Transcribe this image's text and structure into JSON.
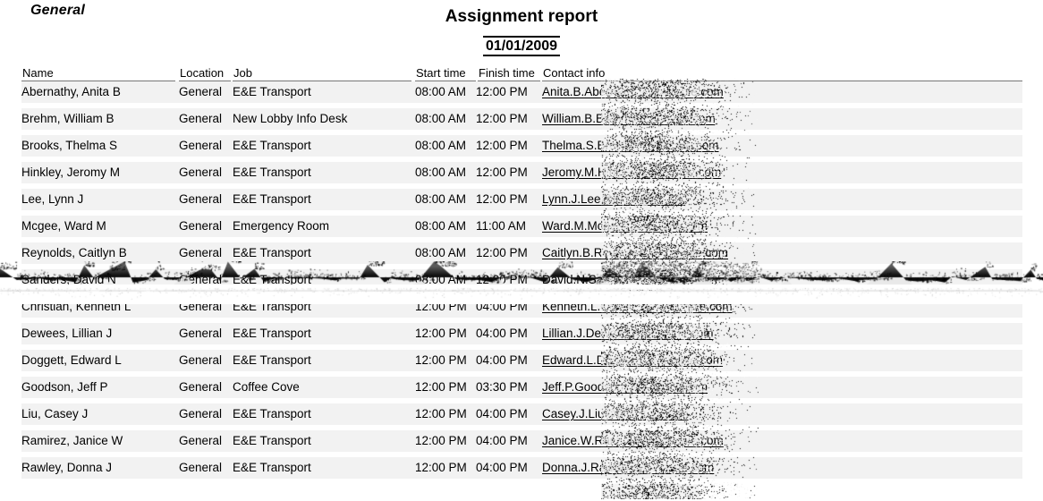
{
  "report": {
    "group_label": "General",
    "title": "Assignment report",
    "date": "01/01/2009"
  },
  "table": {
    "columns": [
      {
        "key": "name",
        "label": "Name"
      },
      {
        "key": "location",
        "label": "Location"
      },
      {
        "key": "job",
        "label": "Job"
      },
      {
        "key": "start",
        "label": "Start time"
      },
      {
        "key": "finish",
        "label": "Finish time"
      },
      {
        "key": "contact",
        "label": "Contact info"
      }
    ],
    "rows": [
      {
        "name": "Abernathy, Anita B",
        "location": "General",
        "job": "E&E Transport",
        "start": "08:00 AM",
        "finish": "12:00 PM",
        "contact": "Anita.B.Abernathy@example.com"
      },
      {
        "name": "Brehm, William B",
        "location": "General",
        "job": "New Lobby Info Desk",
        "start": "08:00 AM",
        "finish": "12:00 PM",
        "contact": "William.B.Brehm@example.com"
      },
      {
        "name": "Brooks, Thelma S",
        "location": "General",
        "job": "E&E Transport",
        "start": "08:00 AM",
        "finish": "12:00 PM",
        "contact": "Thelma.S.Brooks@example.com"
      },
      {
        "name": "Hinkley, Jeromy M",
        "location": "General",
        "job": "E&E Transport",
        "start": "08:00 AM",
        "finish": "12:00 PM",
        "contact": "Jeromy.M.Hinkley@example.com"
      },
      {
        "name": "Lee, Lynn J",
        "location": "General",
        "job": "E&E Transport",
        "start": "08:00 AM",
        "finish": "12:00 PM",
        "contact": "Lynn.J.Lee@example.com"
      },
      {
        "name": "Mcgee, Ward M",
        "location": "General",
        "job": "Emergency Room",
        "start": "08:00 AM",
        "finish": "11:00 AM",
        "contact": "Ward.M.Mcgee@example.com"
      },
      {
        "name": "Reynolds, Caitlyn B",
        "location": "General",
        "job": "E&E Transport",
        "start": "08:00 AM",
        "finish": "12:00 PM",
        "contact": "Caitlyn.B.Reynolds@example.com"
      },
      {
        "name": "Sanders, David N",
        "location": "General",
        "job": "E&E Transport",
        "start": "08:00 AM",
        "finish": "12:00 PM",
        "contact": "David.N.Sanders@example.com"
      },
      {
        "name": "Christian, Kenneth L",
        "location": "General",
        "job": "E&E Transport",
        "start": "12:00 PM",
        "finish": "04:00 PM",
        "contact": "Kenneth.L.Christian@example.com"
      },
      {
        "name": "Dewees, Lillian J",
        "location": "General",
        "job": "E&E Transport",
        "start": "12:00 PM",
        "finish": "04:00 PM",
        "contact": "Lillian.J.Dewees@example.com"
      },
      {
        "name": "Doggett, Edward L",
        "location": "General",
        "job": "E&E Transport",
        "start": "12:00 PM",
        "finish": "04:00 PM",
        "contact": "Edward.L.Doggett@example.com"
      },
      {
        "name": "Goodson, Jeff P",
        "location": "General",
        "job": "Coffee Cove",
        "start": "12:00 PM",
        "finish": "03:30 PM",
        "contact": "Jeff.P.Goodson@example.com"
      },
      {
        "name": "Liu, Casey J",
        "location": "General",
        "job": "E&E Transport",
        "start": "12:00 PM",
        "finish": "04:00 PM",
        "contact": "Casey.J.Liu@example.com"
      },
      {
        "name": "Ramirez, Janice W",
        "location": "General",
        "job": "E&E Transport",
        "start": "12:00 PM",
        "finish": "04:00 PM",
        "contact": "Janice.W.Ramirez@example.com"
      },
      {
        "name": "Rawley, Donna J",
        "location": "General",
        "job": "E&E Transport",
        "start": "12:00 PM",
        "finish": "04:00 PM",
        "contact": "Donna.J.Rawley@example.com"
      }
    ]
  },
  "style": {
    "row_background": "#f2f2f2",
    "page_background": "#ffffff",
    "text_color": "#000000",
    "rule_color": "#777777"
  },
  "artifacts": {
    "redaction_note": "contact-info column obscured by static noise",
    "tear_note": "horizontal torn-paper rip across row 8"
  }
}
